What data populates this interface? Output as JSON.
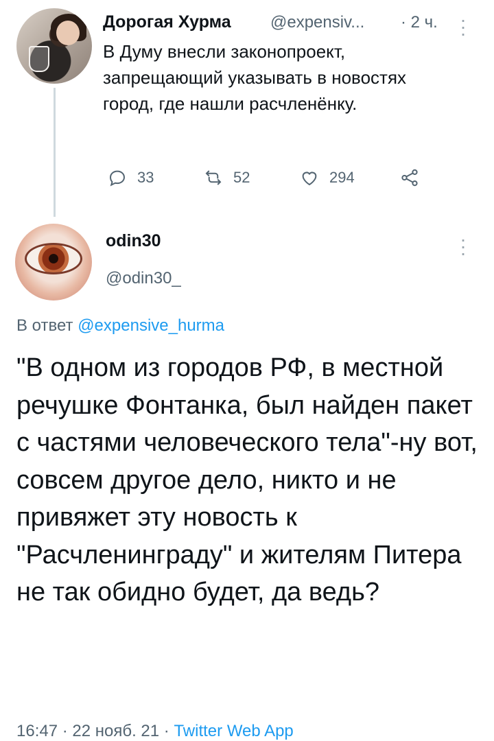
{
  "tweet1": {
    "author_name": "Дорогая Хурма",
    "handle": "@expensiv...",
    "time": "· 2 ч.",
    "text": "В Думу внесли законопроект, запрещающий указывать в новостях город, где нашли расчленёнку.",
    "reply_count": "33",
    "retweet_count": "52",
    "like_count": "294"
  },
  "tweet2": {
    "author_name": "odin30",
    "handle": "@odin30_",
    "reply_prefix": "В ответ",
    "reply_mention": "@expensive_hurma",
    "text": "\"В одном из городов РФ, в местной речушке Фонтанка, был найден пакет с частями человеческого тела\"-ну вот, совсем другое дело, никто и не привяжет эту новость к \"Расчленинграду\" и жителям Питера не так обидно будет, да ведь?",
    "timestamp": "16:47 · 22 нояб. 21 ·",
    "source": "Twitter Web App"
  },
  "icons": {
    "reply": "reply-icon",
    "retweet": "retweet-icon",
    "like": "like-icon",
    "share": "share-icon",
    "more": "more-vertical-icon"
  },
  "colors": {
    "text": "#0f1419",
    "muted": "#536471",
    "link": "#1d9bf0",
    "thread_line": "#cfd9de"
  }
}
